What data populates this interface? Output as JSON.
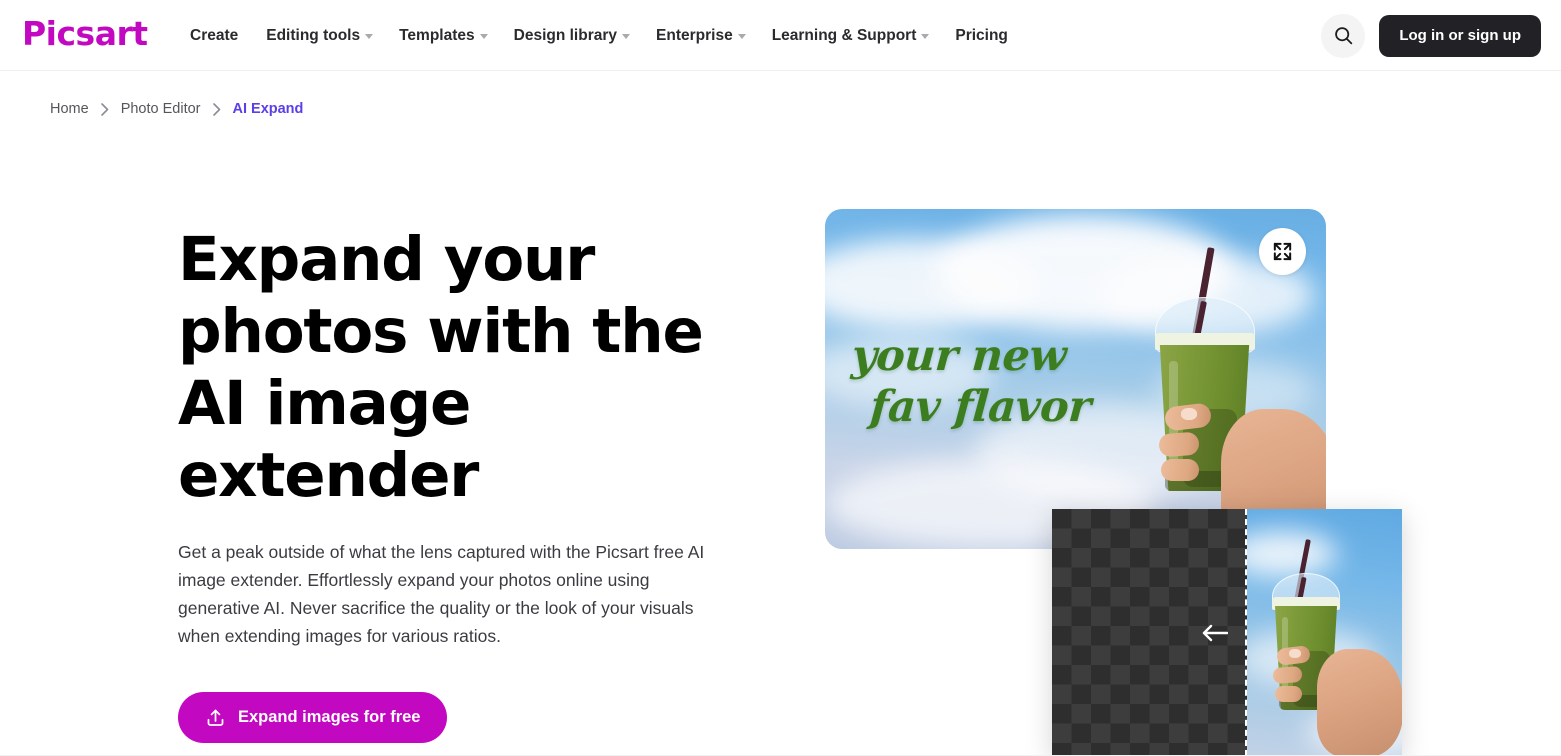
{
  "header": {
    "logo_text": "Picsart",
    "logo_color": "#C209C1",
    "nav_items": [
      {
        "label": "Create",
        "has_dropdown": false
      },
      {
        "label": "Editing tools",
        "has_dropdown": true
      },
      {
        "label": "Templates",
        "has_dropdown": true
      },
      {
        "label": "Design library",
        "has_dropdown": true
      },
      {
        "label": "Enterprise",
        "has_dropdown": true
      },
      {
        "label": "Learning & Support",
        "has_dropdown": true
      },
      {
        "label": "Pricing",
        "has_dropdown": false
      }
    ],
    "search_icon": "search-icon",
    "login_label": "Log in or sign up",
    "login_bg": "#212126"
  },
  "breadcrumb": {
    "items": [
      {
        "label": "Home",
        "current": false
      },
      {
        "label": "Photo Editor",
        "current": false
      },
      {
        "label": "AI Expand",
        "current": true
      }
    ],
    "separator": "›",
    "current_color": "#5B3FE8"
  },
  "hero": {
    "title": "Expand your photos with the AI image extender",
    "description": "Get a peak outside of what the lens captured with the Picsart free AI image extender. Effortlessly expand your photos online using generative AI. Never sacrifice the quality or the look of your visuals when extending images for various ratios.",
    "cta_label": "Expand images for free",
    "cta_icon": "upload-icon",
    "cta_bg": "#C209C1"
  },
  "hero_image": {
    "overlay_text_line1": "your new",
    "overlay_text_line2": "fav flavor",
    "overlay_text_color": "#3C7E1F",
    "expand_icon": "expand-arrows-icon",
    "subject": "hand holding green matcha iced drink against blue sky with clouds"
  },
  "overlay_card": {
    "transparency_pattern": "checkerboard",
    "divider_style": "dashed",
    "arrow_icon": "arrow-left-icon",
    "subject": "hand holding green matcha iced drink against blue sky"
  }
}
